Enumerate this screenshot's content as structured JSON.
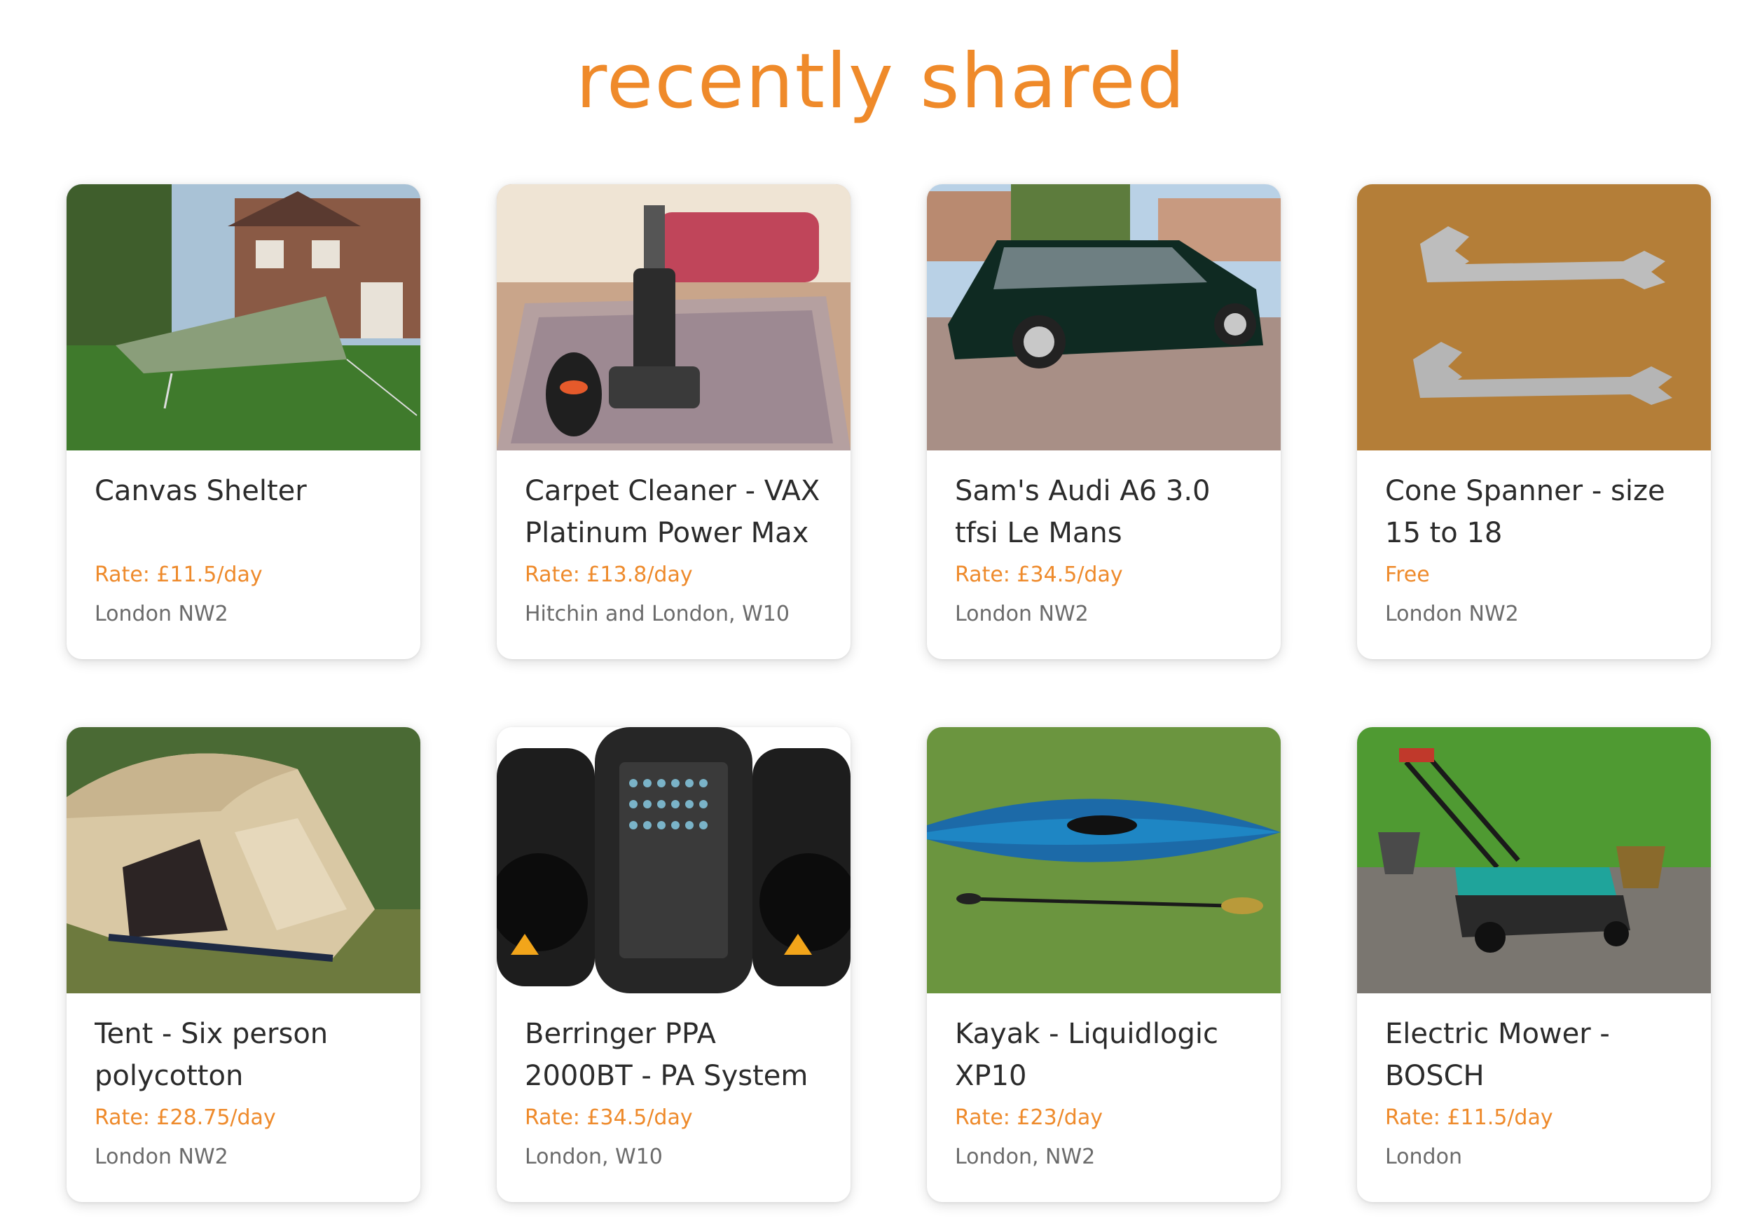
{
  "heading": "recently shared",
  "colors": {
    "accent": "#ee8a2b",
    "title": "#2b2b2b",
    "location": "#6b6b6b"
  },
  "listings": [
    {
      "title": "Canvas Shelter",
      "rate": "Rate: £11.5/day",
      "location": "London NW2",
      "image": "canvas-shelter-photo"
    },
    {
      "title": "Carpet Cleaner - VAX Platinum Power Max",
      "rate": "Rate: £13.8/day",
      "location": "Hitchin and London, W10",
      "image": "carpet-cleaner-photo"
    },
    {
      "title": "Sam's Audi A6 3.0 tfsi Le Mans",
      "rate": "Rate: £34.5/day",
      "location": "London NW2",
      "image": "audi-car-photo"
    },
    {
      "title": "Cone Spanner - size 15 to 18",
      "rate": "Free",
      "location": "London NW2",
      "image": "cone-spanner-photo"
    },
    {
      "title": "Tent - Six person polycotton",
      "rate": "Rate: £28.75/day",
      "location": "London NW2",
      "image": "tent-photo"
    },
    {
      "title": "Berringer PPA 2000BT - PA System",
      "rate": "Rate: £34.5/day",
      "location": "London, W10",
      "image": "pa-system-photo"
    },
    {
      "title": "Kayak - Liquidlogic XP10",
      "rate": "Rate: £23/day",
      "location": "London, NW2",
      "image": "kayak-photo"
    },
    {
      "title": "Electric Mower - BOSCH",
      "rate": "Rate: £11.5/day",
      "location": "London",
      "image": "lawn-mower-photo"
    }
  ]
}
